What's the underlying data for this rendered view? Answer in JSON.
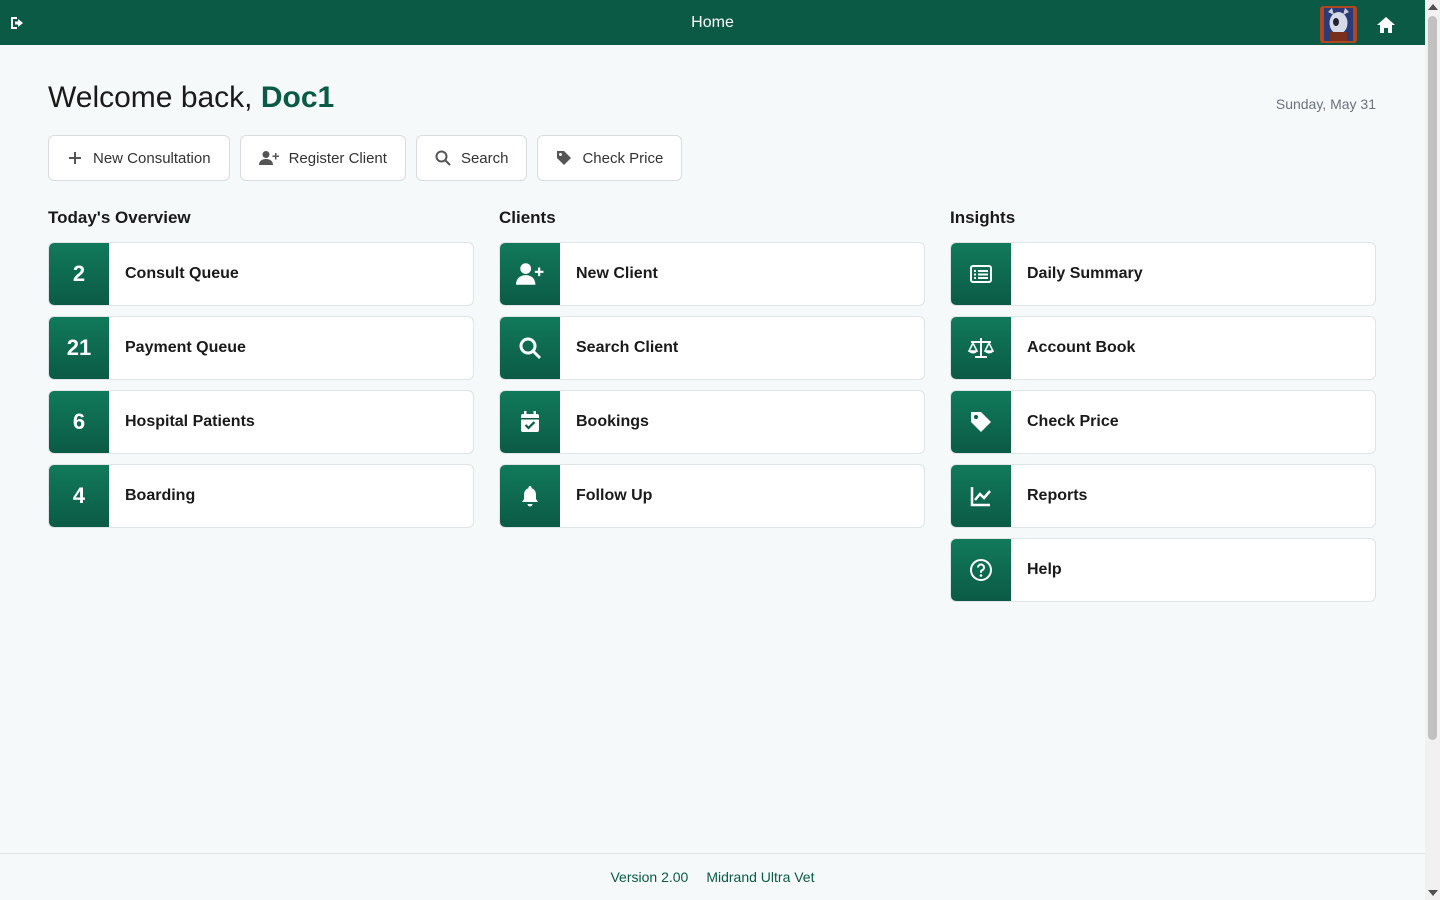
{
  "header": {
    "title": "Home",
    "bg_color": "#0b5a45",
    "logout_icon": "sign-out-icon",
    "avatar_icon": "user-avatar",
    "home_icon": "home-icon"
  },
  "welcome": {
    "prefix": "Welcome back,",
    "username": "Doc1",
    "date": "Sunday, May 31"
  },
  "quick_actions": [
    {
      "label": "New Consultation",
      "icon": "plus-icon"
    },
    {
      "label": "Register Client",
      "icon": "user-plus-icon"
    },
    {
      "label": "Search",
      "icon": "search-icon"
    },
    {
      "label": "Check Price",
      "icon": "tag-icon"
    }
  ],
  "overview": {
    "title": "Today's Overview",
    "items": [
      {
        "count": "2",
        "label": "Consult Queue"
      },
      {
        "count": "21",
        "label": "Payment Queue"
      },
      {
        "count": "6",
        "label": "Hospital Patients"
      },
      {
        "count": "4",
        "label": "Boarding"
      }
    ]
  },
  "clients": {
    "title": "Clients",
    "items": [
      {
        "label": "New Client",
        "icon": "user-plus-icon"
      },
      {
        "label": "Search Client",
        "icon": "search-icon"
      },
      {
        "label": "Bookings",
        "icon": "calendar-check-icon"
      },
      {
        "label": "Follow Up",
        "icon": "bell-icon"
      }
    ]
  },
  "insights": {
    "title": "Insights",
    "items": [
      {
        "label": "Daily Summary",
        "icon": "list-alt-icon"
      },
      {
        "label": "Account Book",
        "icon": "balance-scale-icon"
      },
      {
        "label": "Check Price",
        "icon": "tag-icon"
      },
      {
        "label": "Reports",
        "icon": "chart-line-icon"
      },
      {
        "label": "Help",
        "icon": "question-circle-icon"
      }
    ]
  },
  "footer": {
    "version": "Version 2.00",
    "app_name": "Midrand Ultra Vet"
  }
}
